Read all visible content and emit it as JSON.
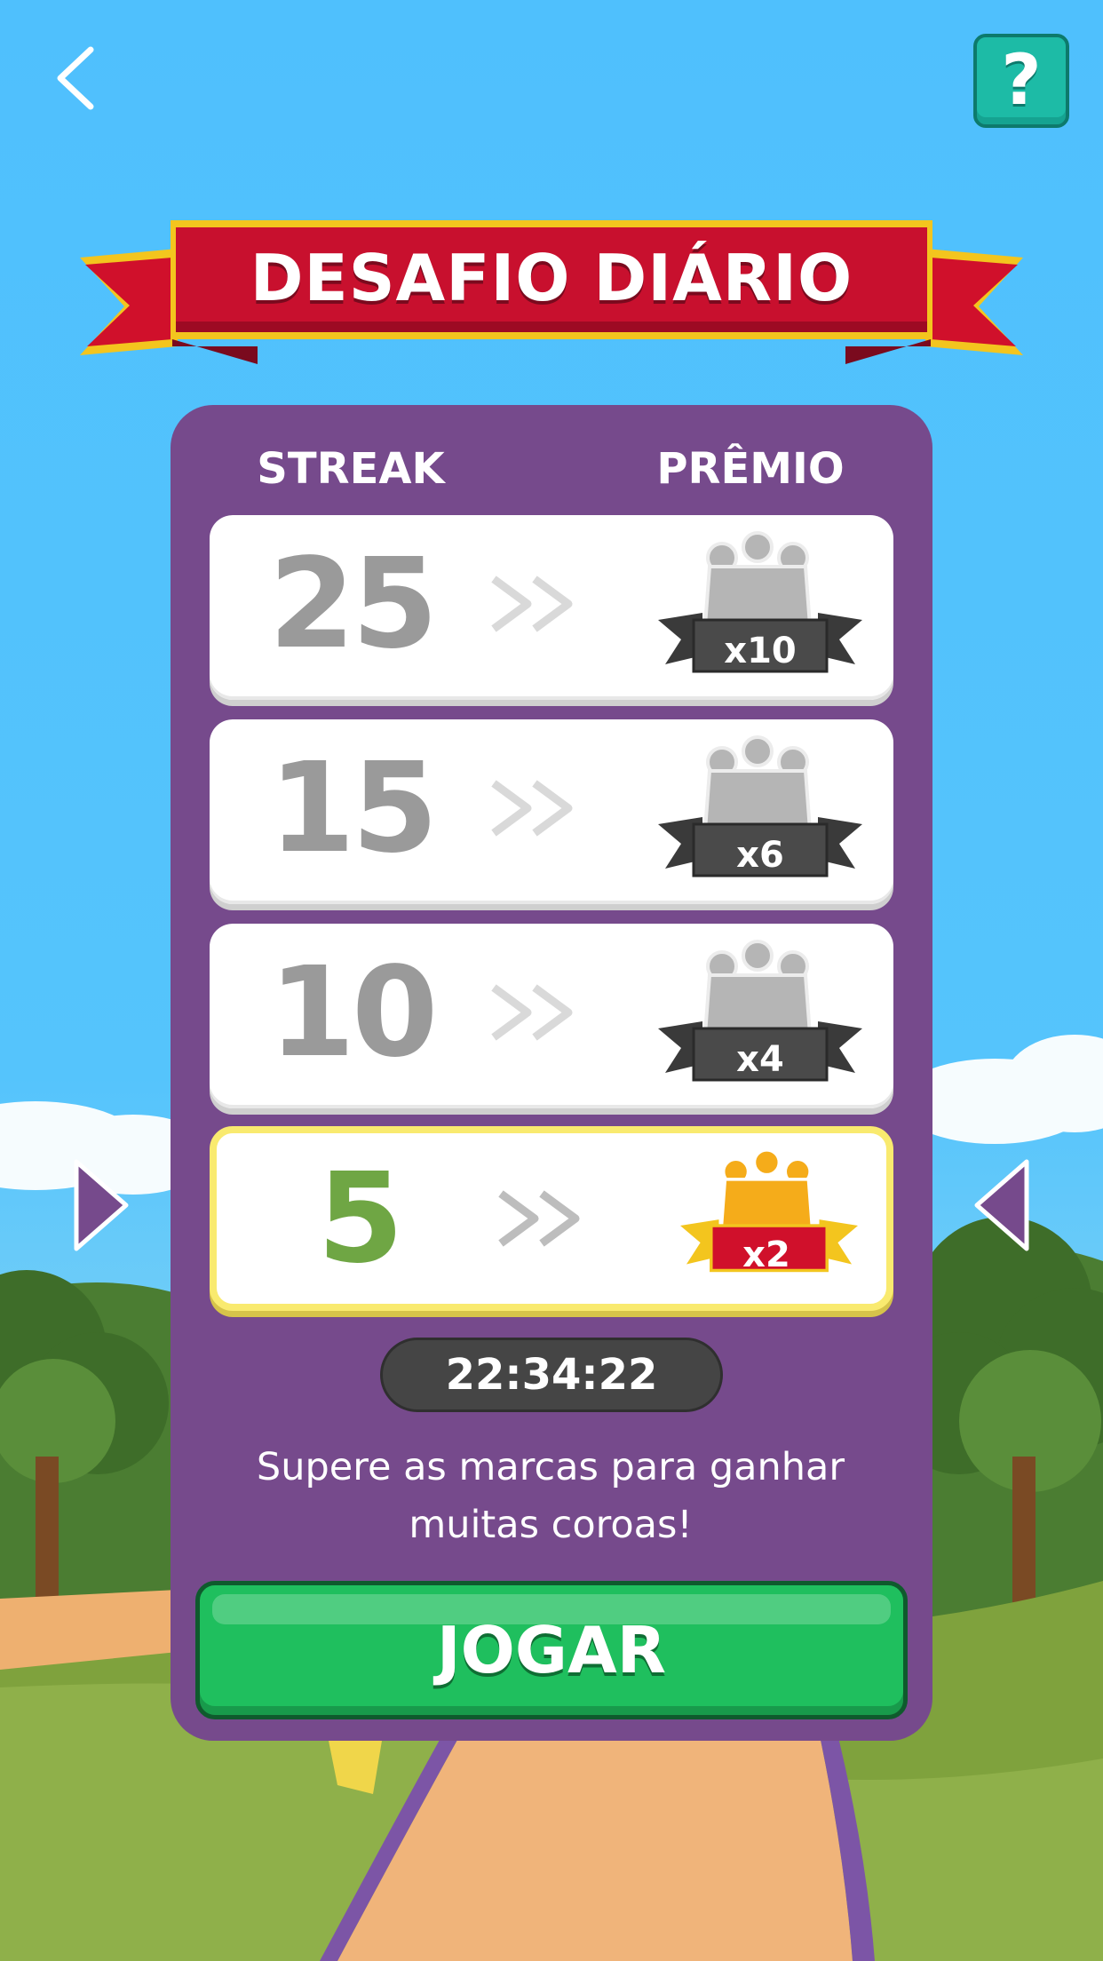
{
  "header": {
    "back_icon": "chevron-left-icon",
    "help_label": "?"
  },
  "banner": {
    "title": "DESAFIO DIÁRIO"
  },
  "table": {
    "streak_header": "STREAK",
    "prize_header": "PRÊMIO",
    "rows": [
      {
        "streak": "25",
        "multiplier": "x10",
        "active": false
      },
      {
        "streak": "15",
        "multiplier": "x6",
        "active": false
      },
      {
        "streak": "10",
        "multiplier": "x4",
        "active": false
      },
      {
        "streak": "5",
        "multiplier": "x2",
        "active": true
      }
    ]
  },
  "timer": "22:34:22",
  "description": "Supere as marcas para ganhar muitas coroas!",
  "play_button": "JOGAR",
  "colors": {
    "sky": "#4fc0fd",
    "card": "#764a8c",
    "ribbon": "#c8102e",
    "play": "#1fbf5e",
    "help": "#1dbba6",
    "crown_gold": "#f5ac1a",
    "crown_silver": "#b5b5b5"
  }
}
